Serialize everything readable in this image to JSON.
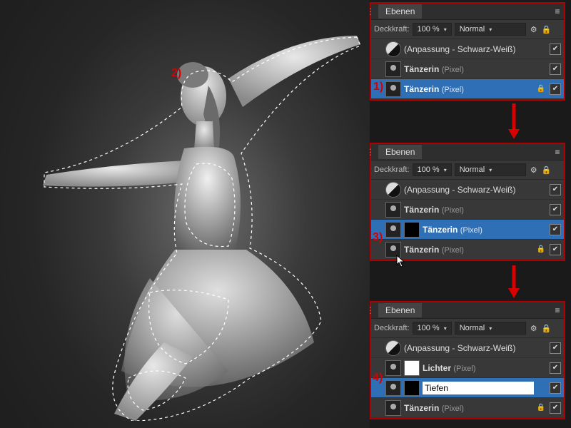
{
  "annotations": {
    "a1": "1)",
    "a2": "2)",
    "a3": "3)",
    "a4": "4)"
  },
  "panels": {
    "tab_label": "Ebenen",
    "opacity_label": "Deckkraft:",
    "opacity_value": "100 %",
    "blend_mode": "Normal",
    "adjust_layer": "(Anpassung - Schwarz-Weiß)",
    "dancer_name": "Tänzerin",
    "pixel_suffix": "(Pixel)",
    "lichter_name": "Lichter",
    "tiefen_value": "Tiefen"
  },
  "icons": {
    "caret": "▾",
    "check": "✔",
    "gear": "⚙",
    "lock": "🔒",
    "menu": "≡"
  }
}
